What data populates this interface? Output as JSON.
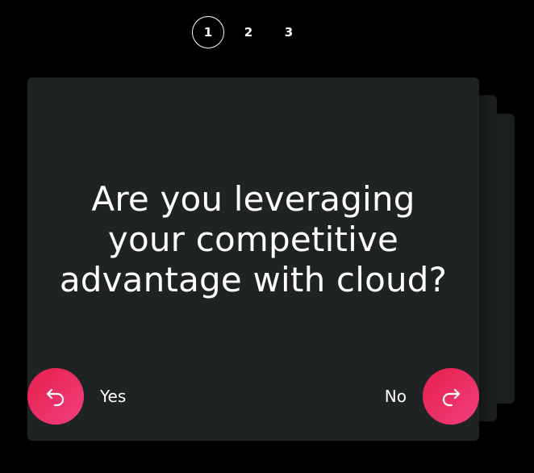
{
  "stepper": {
    "steps": [
      "1",
      "2",
      "3"
    ],
    "active_step": "1"
  },
  "card": {
    "question": "Are you leveraging your competitive advantage with cloud?",
    "yes_label": "Yes",
    "no_label": "No",
    "yes_icon": "undo-arrow-icon",
    "no_icon": "redo-arrow-icon"
  },
  "colors": {
    "background": "#000000",
    "card": "#202324",
    "accent_start": "#e51f4c",
    "accent_end": "#f23f7d",
    "text": "#ffffff"
  }
}
